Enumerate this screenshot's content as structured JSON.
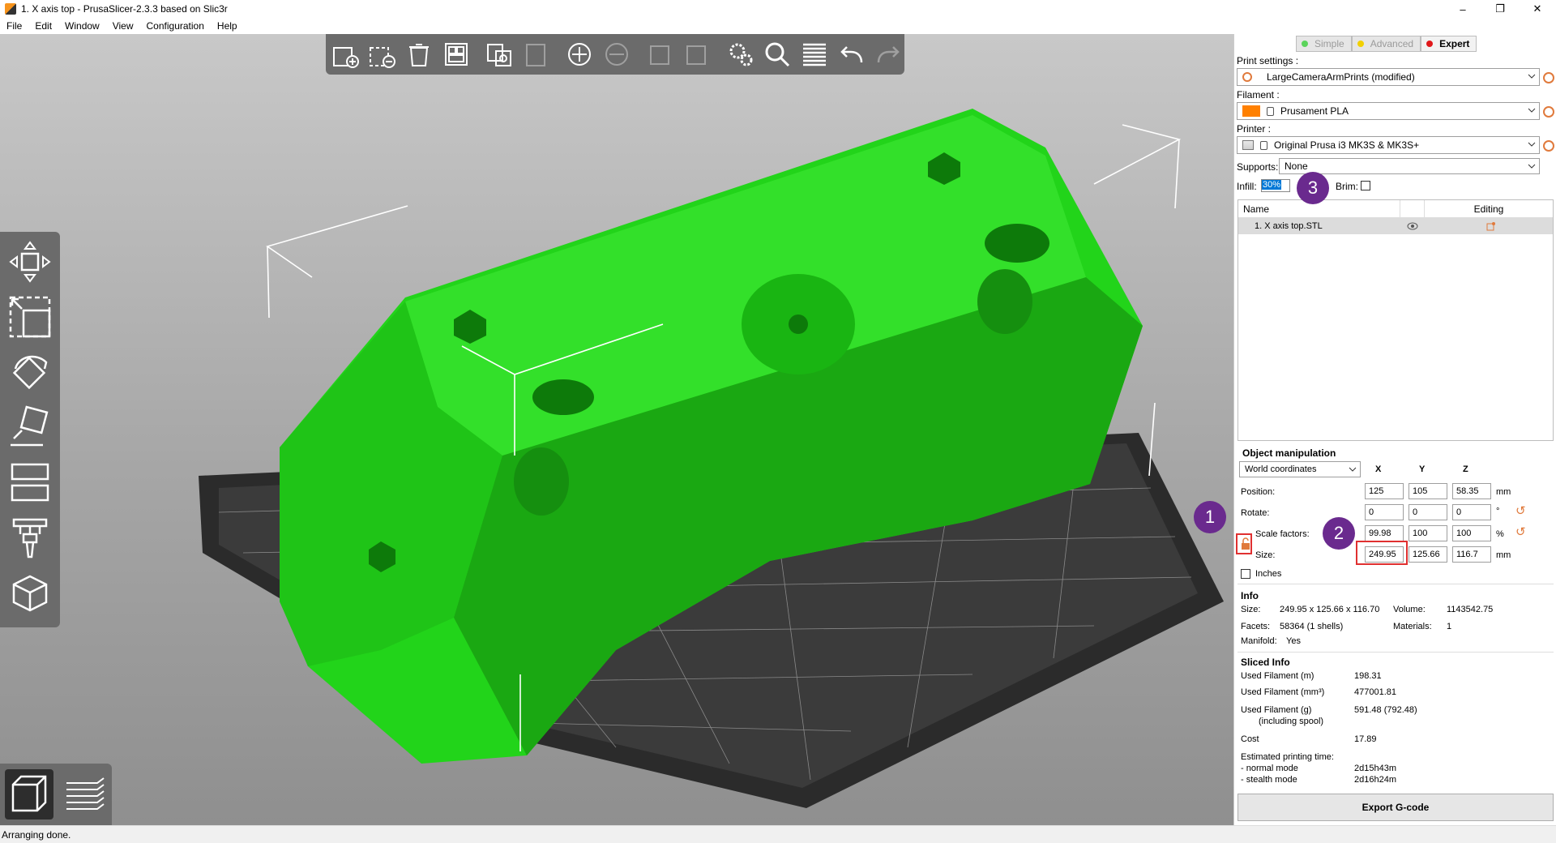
{
  "window": {
    "title": "1. X axis top - PrusaSlicer-2.3.3 based on Slic3r",
    "controls": [
      "–",
      "❐",
      "✕"
    ]
  },
  "menu": [
    "File",
    "Edit",
    "Window",
    "View",
    "Configuration",
    "Help"
  ],
  "modes": [
    {
      "label": "Simple",
      "color": "#5bd45b"
    },
    {
      "label": "Advanced",
      "color": "#f2d000"
    },
    {
      "label": "Expert",
      "color": "#e0181a"
    }
  ],
  "print_settings": {
    "label": "Print settings :",
    "value": "LargeCameraArmPrints (modified)"
  },
  "filament": {
    "label": "Filament :",
    "value": "Prusament PLA",
    "color": "#ff8000"
  },
  "printer": {
    "label": "Printer :",
    "value": "Original Prusa i3 MK3S & MK3S+"
  },
  "supports": {
    "label": "Supports:",
    "value": "None"
  },
  "infill": {
    "label": "Infill:",
    "value": "30%"
  },
  "brim": {
    "label": "Brim:"
  },
  "object_list": {
    "col_name": "Name",
    "col_editing": "Editing",
    "items": [
      {
        "name": "1. X axis top.STL"
      }
    ]
  },
  "object_manipulation": {
    "title": "Object manipulation",
    "coord_system": "World coordinates",
    "axes": [
      "X",
      "Y",
      "Z"
    ],
    "position": {
      "label": "Position:",
      "x": "125",
      "y": "105",
      "z": "58.35",
      "unit": "mm"
    },
    "rotate": {
      "label": "Rotate:",
      "x": "0",
      "y": "0",
      "z": "0",
      "unit": "°"
    },
    "scale": {
      "label": "Scale factors:",
      "x": "99.98",
      "y": "100",
      "z": "100",
      "unit": "%"
    },
    "size": {
      "label": "Size:",
      "x": "249.95",
      "y": "125.66",
      "z": "116.7",
      "unit": "mm"
    },
    "inches_label": "Inches"
  },
  "info": {
    "title": "Info",
    "size_label": "Size:",
    "size_value": "249.95 x 125.66 x 116.70",
    "volume_label": "Volume:",
    "volume_value": "1143542.75",
    "facets_label": "Facets:",
    "facets_value": "58364 (1 shells)",
    "materials_label": "Materials:",
    "materials_value": "1",
    "manifold_label": "Manifold:",
    "manifold_value": "Yes"
  },
  "sliced_info": {
    "title": "Sliced Info",
    "rows": [
      {
        "label": "Used Filament (m)",
        "value": "198.31"
      },
      {
        "label": "Used Filament (mm³)",
        "value": "477001.81"
      },
      {
        "label": "Used Filament (g)",
        "value": "591.48 (792.48)"
      },
      {
        "label": "(including spool)",
        "value": ""
      },
      {
        "label": "Cost",
        "value": "17.89"
      },
      {
        "label": "Estimated printing time:",
        "value": ""
      },
      {
        "label": "- normal mode",
        "value": "2d15h43m"
      },
      {
        "label": "- stealth mode",
        "value": "2d16h24m"
      }
    ]
  },
  "export_button": "Export G-code",
  "annotations": [
    "1",
    "2",
    "3"
  ],
  "status": "Arranging done."
}
